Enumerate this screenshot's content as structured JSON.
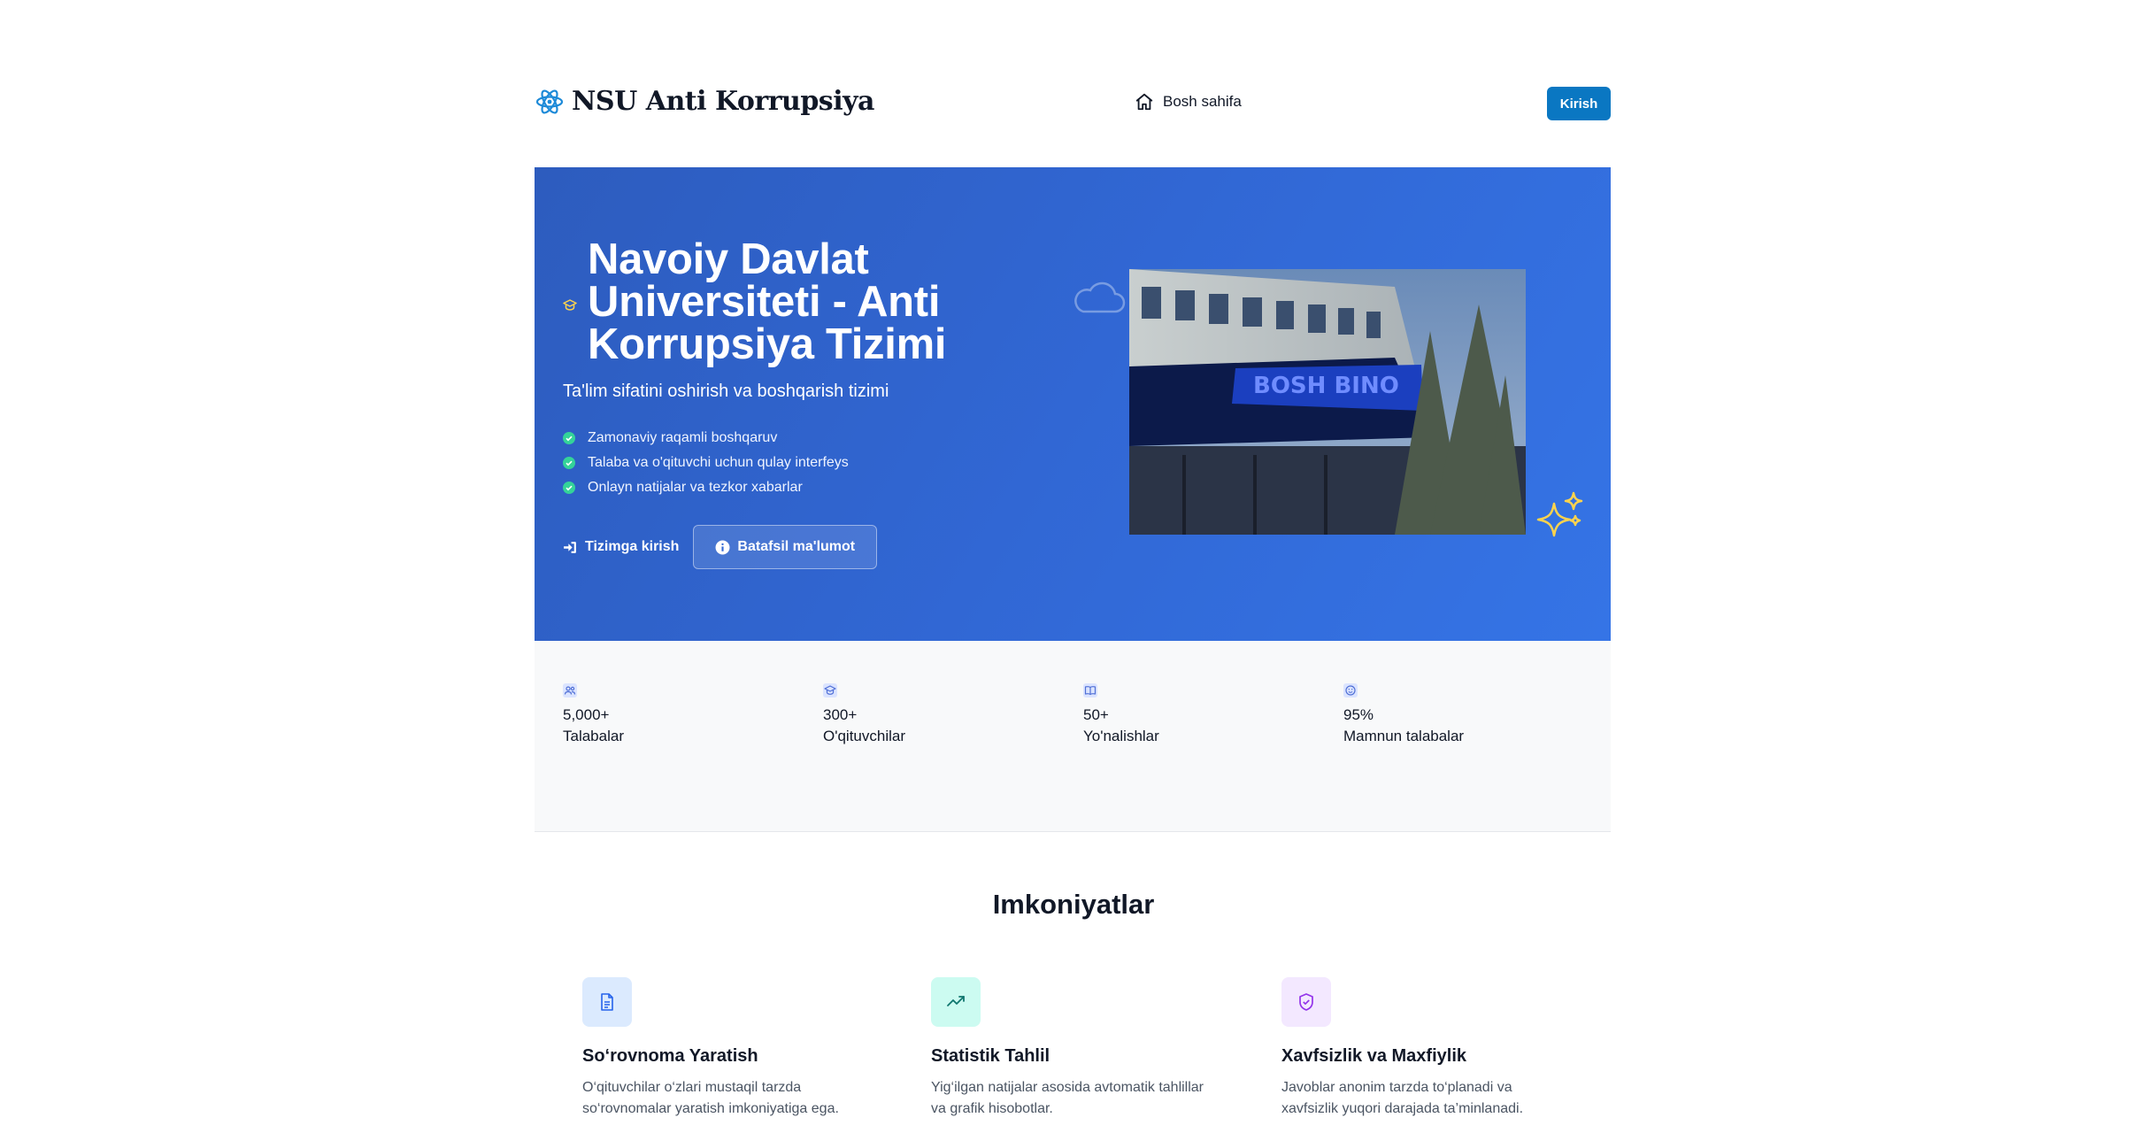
{
  "brand": {
    "name": "NSU Anti Korrupsiya",
    "icon": "atom-icon"
  },
  "nav": {
    "home_label": "Bosh sahifa",
    "home_icon": "home-icon",
    "login_label": "Kirish"
  },
  "hero": {
    "title": "Navoiy Davlat Universiteti - Anti Korrupsiya Tizimi",
    "subtitle": "Ta'lim sifatini oshirish va boshqarish tizimi",
    "features": [
      "Zamonaviy raqamli boshqaruv",
      "Talaba va o'qituvchi uchun qulay interfeys",
      "Onlayn natijalar va tezkor xabarlar"
    ],
    "login_action": "Tizimga kirish",
    "more_action": "Batafsil ma'lumot",
    "photo_sign": "BOSH BINO",
    "colors": {
      "primary": "#3167d4",
      "accent": "#fcd34d",
      "check": "#34d399"
    }
  },
  "stats": [
    {
      "value": "5,000+",
      "label": "Talabalar",
      "icon": "users-icon"
    },
    {
      "value": "300+",
      "label": "O'qituvchilar",
      "icon": "graduation-cap-icon"
    },
    {
      "value": "50+",
      "label": "Yo'nalishlar",
      "icon": "book-open-icon"
    },
    {
      "value": "95%",
      "label": "Mamnun talabalar",
      "icon": "smile-icon"
    }
  ],
  "features_section": {
    "title": "Imkoniyatlar",
    "cards": [
      {
        "title": "So‘rovnoma Yaratish",
        "text": "O‘qituvchilar o‘zlari mustaqil tarzda so‘rovnomalar yaratish imkoniyatiga ega.",
        "icon": "document-icon",
        "color": "#dbeafe"
      },
      {
        "title": "Statistik Tahlil",
        "text": "Yig‘ilgan natijalar asosida avtomatik tahlillar va grafik hisobotlar.",
        "icon": "trending-up-icon",
        "color": "#ccfbf1"
      },
      {
        "title": "Xavfsizlik va Maxfiylik",
        "text": "Javoblar anonim tarzda to‘planadi va xavfsizlik yuqori darajada ta’minlanadi.",
        "icon": "shield-check-icon",
        "color": "#f3e8ff"
      }
    ]
  }
}
